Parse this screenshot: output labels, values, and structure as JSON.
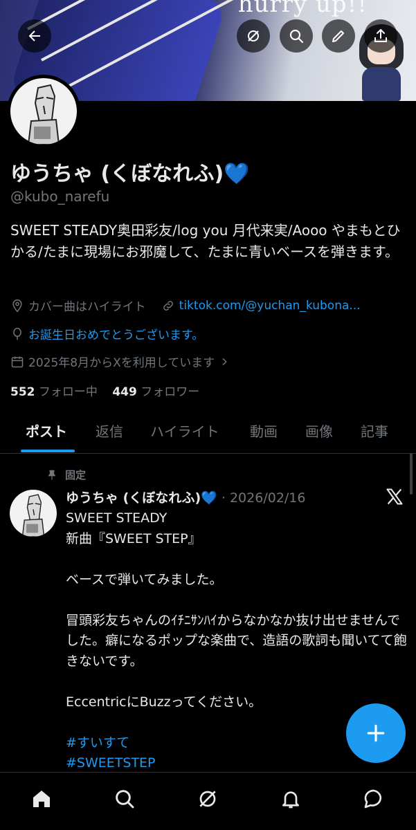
{
  "banner": {
    "overlay_text": "hurry up!!"
  },
  "header_buttons": {
    "back": "arrow-left-icon",
    "grok": "grok-icon",
    "search": "search-icon",
    "edit": "pencil-icon",
    "share": "share-icon"
  },
  "profile": {
    "name": "ゆうちゃ (くぼなれふ)💙",
    "handle": "@kubo_narefu",
    "bio": "SWEET STEADY奥田彩友/log you 月代来実/Aooo やまもとひかる/たまに現場にお邪魔して、たまに青いベースを弾きます。",
    "location": "カバー曲はハイライト",
    "website": "tiktok.com/@yuchan_kubona...",
    "birthday": "お誕生日おめでとうございます。",
    "joined": "2025年8月からXを利用しています",
    "following_count": "552",
    "following_label": "フォロー中",
    "followers_count": "449",
    "followers_label": "フォロワー"
  },
  "tabs": [
    {
      "label": "ポスト",
      "active": true
    },
    {
      "label": "返信"
    },
    {
      "label": "ハイライト"
    },
    {
      "label": "動画"
    },
    {
      "label": "画像"
    },
    {
      "label": "記事"
    }
  ],
  "pinned_post": {
    "pinned_label": "固定",
    "author": "ゆうちゃ (くぼなれふ)💙",
    "date": "· 2026/02/16",
    "lines": {
      "l1": "SWEET STEADY",
      "l2": "新曲『SWEET STEP』",
      "l3": "ベースで弾いてみました。",
      "l4": "冒頭彩友ちゃんのｲﾁﾆｻﾝﾊｲからなかなか抜け出せませんでした。癖になるポップな楽曲で、造語の歌詞も聞いてて飽きないです。",
      "l5": "EccentricにBuzzってください。",
      "tag1": "#すいすて",
      "tag2": "#SWEETSTEP"
    }
  },
  "fab": {
    "icon": "plus-icon"
  },
  "bottom_nav": [
    {
      "icon": "home-icon",
      "active": true
    },
    {
      "icon": "search-icon"
    },
    {
      "icon": "grok-icon"
    },
    {
      "icon": "bell-icon"
    },
    {
      "icon": "chat-icon"
    }
  ],
  "colors": {
    "accent": "#1d9bf0",
    "background": "#000000",
    "muted": "#71767b",
    "text": "#e7e9ea"
  }
}
